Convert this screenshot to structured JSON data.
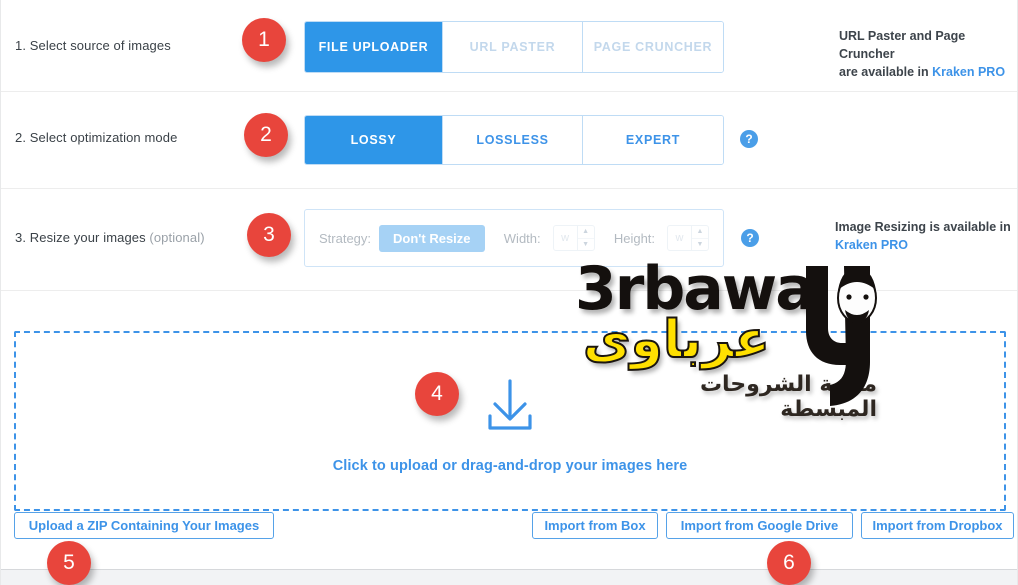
{
  "steps": [
    {
      "number": "1",
      "label": "1. Select source of images",
      "label_optional": "",
      "tabs": [
        {
          "label": "FILE UPLOADER",
          "state": "active"
        },
        {
          "label": "URL PASTER",
          "state": "disabled"
        },
        {
          "label": "PAGE CRUNCHER",
          "state": "disabled"
        }
      ],
      "note_line1": "URL Paster and Page Cruncher",
      "note_line2_prefix": "are available in ",
      "note_link": "Kraken PRO"
    },
    {
      "number": "2",
      "label": "2. Select optimization mode",
      "tabs": [
        {
          "label": "LOSSY",
          "state": "active"
        },
        {
          "label": "LOSSLESS",
          "state": "normal"
        },
        {
          "label": "EXPERT",
          "state": "normal"
        }
      ],
      "help_icon": "question-mark-icon",
      "help_label": "?"
    },
    {
      "number": "3",
      "label": "3. Resize your images ",
      "label_optional": "(optional)",
      "strategy_label": "Strategy:",
      "strategy_value": "Don't Resize",
      "width_label": "Width:",
      "width_value": "w",
      "height_label": "Height:",
      "height_value": "w",
      "help_icon": "question-mark-icon",
      "help_label": "?",
      "note_line1": "Image Resizing is available in",
      "note_link": "Kraken PRO"
    }
  ],
  "dropzone": {
    "number": "4",
    "icon": "download-arrow-icon",
    "text": "Click to upload or drag-and-drop your images here"
  },
  "actions": {
    "zip_button": "Upload a ZIP Containing Your Images",
    "zip_badge": "5",
    "import_badge": "6",
    "imports": [
      {
        "label": "Import from Box"
      },
      {
        "label": "Import from Google Drive"
      },
      {
        "label": "Import from Dropbox"
      }
    ]
  },
  "watermark": {
    "main": "3rbawa",
    "arabic": "عرباوى",
    "tagline": "منصة الشروحات المبسطة"
  },
  "colors": {
    "primary_blue": "#2e96e8",
    "link_blue": "#3d93e8",
    "badge_red": "#e8453c",
    "strategy_blue": "#a6d2f5",
    "watermark_yellow": "#ffe000"
  }
}
